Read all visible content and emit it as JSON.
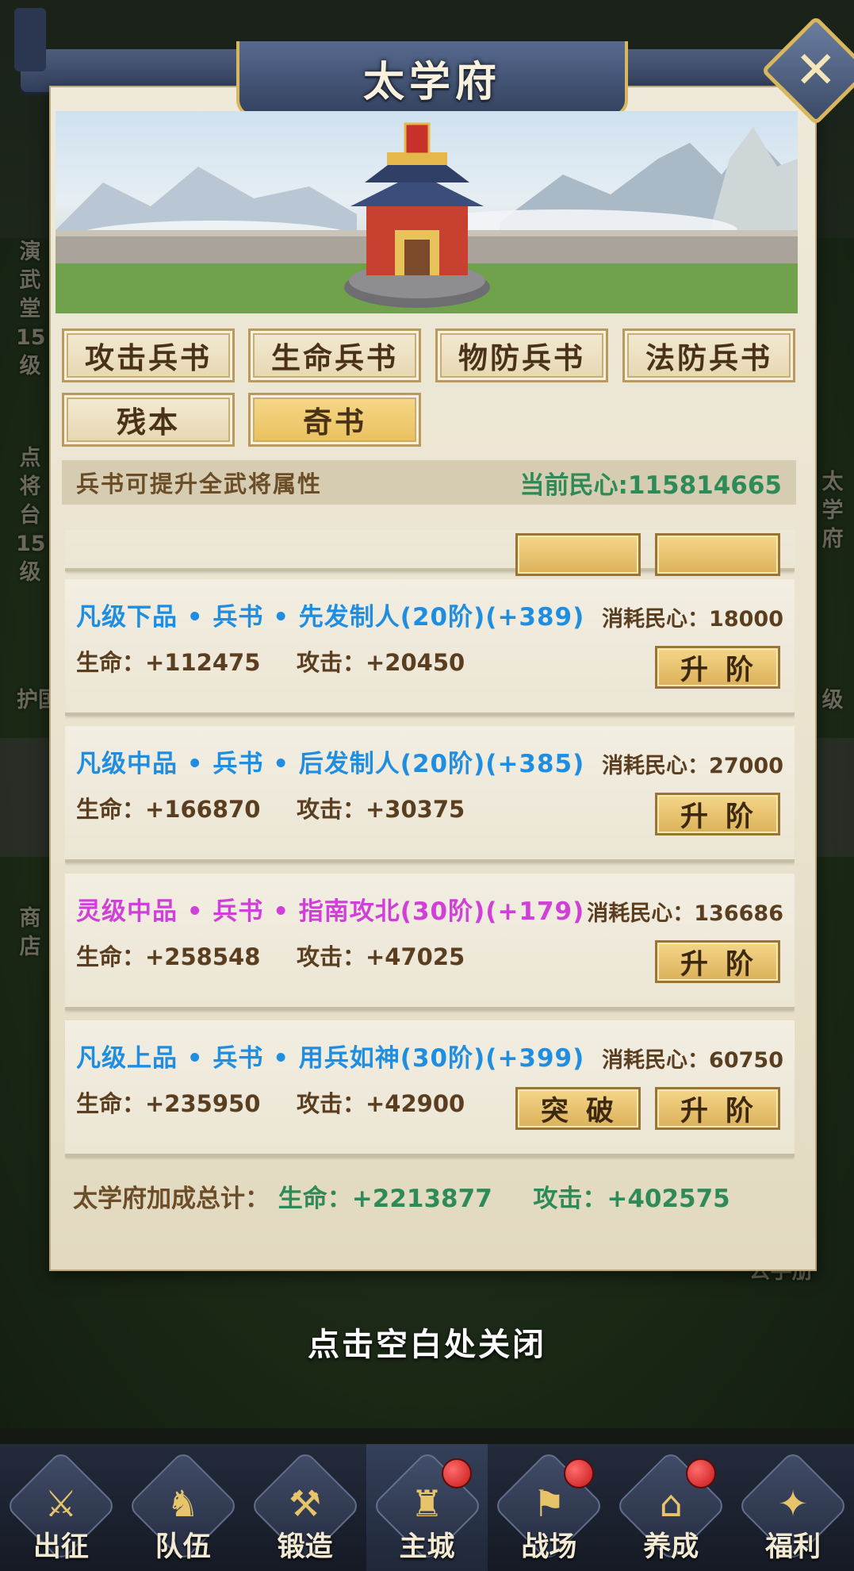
{
  "window": {
    "title": "太学府"
  },
  "background": {
    "side_labels": [
      "演武堂15级",
      "点将台15级",
      "护国",
      "商店",
      "太学府",
      "级",
      "公手册"
    ]
  },
  "tabs": [
    {
      "label": "攻击兵书",
      "active": false
    },
    {
      "label": "生命兵书",
      "active": false
    },
    {
      "label": "物防兵书",
      "active": false
    },
    {
      "label": "法防兵书",
      "active": false
    },
    {
      "label": "残本",
      "active": false
    },
    {
      "label": "奇书",
      "active": true
    }
  ],
  "info": {
    "description": "兵书可提升全武将属性",
    "morale": "当前民心:115814665"
  },
  "books": [
    {
      "title": "凡级下品 • 兵书 • 先发制人(20阶)(+389)",
      "cost": "消耗民心：18000",
      "hp": "生命：+112475",
      "atk": "攻击：+20450",
      "buttons": [
        "升阶"
      ],
      "color": "#1f8de0"
    },
    {
      "title": "凡级中品 • 兵书 • 后发制人(20阶)(+385)",
      "cost": "消耗民心：27000",
      "hp": "生命：+166870",
      "atk": "攻击：+30375",
      "buttons": [
        "升阶"
      ],
      "color": "#1f8de0"
    },
    {
      "title": "灵级中品 • 兵书 • 指南攻北(30阶)(+179)",
      "cost": "消耗民心：136686",
      "hp": "生命：+258548",
      "atk": "攻击：+47025",
      "buttons": [
        "升阶"
      ],
      "color": "#d040d8"
    },
    {
      "title": "凡级上品 • 兵书 • 用兵如神(30阶)(+399)",
      "cost": "消耗民心：60750",
      "hp": "生命：+235950",
      "atk": "攻击：+42900",
      "buttons": [
        "突破",
        "升阶"
      ],
      "color": "#1f8de0"
    }
  ],
  "total": {
    "label": "太学府加成总计：",
    "hp": "生命：+2213877",
    "atk": "攻击：+402575"
  },
  "close_hint": "点击空白处关闭",
  "nav": [
    {
      "label": "出征",
      "icon": "swords-icon",
      "badge": false,
      "active": false
    },
    {
      "label": "队伍",
      "icon": "warrior-icon",
      "badge": false,
      "active": false
    },
    {
      "label": "锻造",
      "icon": "forge-icon",
      "badge": false,
      "active": false
    },
    {
      "label": "主城",
      "icon": "castle-icon",
      "badge": true,
      "active": true
    },
    {
      "label": "战场",
      "icon": "battlefield-icon",
      "badge": true,
      "active": false
    },
    {
      "label": "养成",
      "icon": "pagoda-icon",
      "badge": true,
      "active": false
    },
    {
      "label": "福利",
      "icon": "gift-icon",
      "badge": false,
      "active": false
    }
  ]
}
